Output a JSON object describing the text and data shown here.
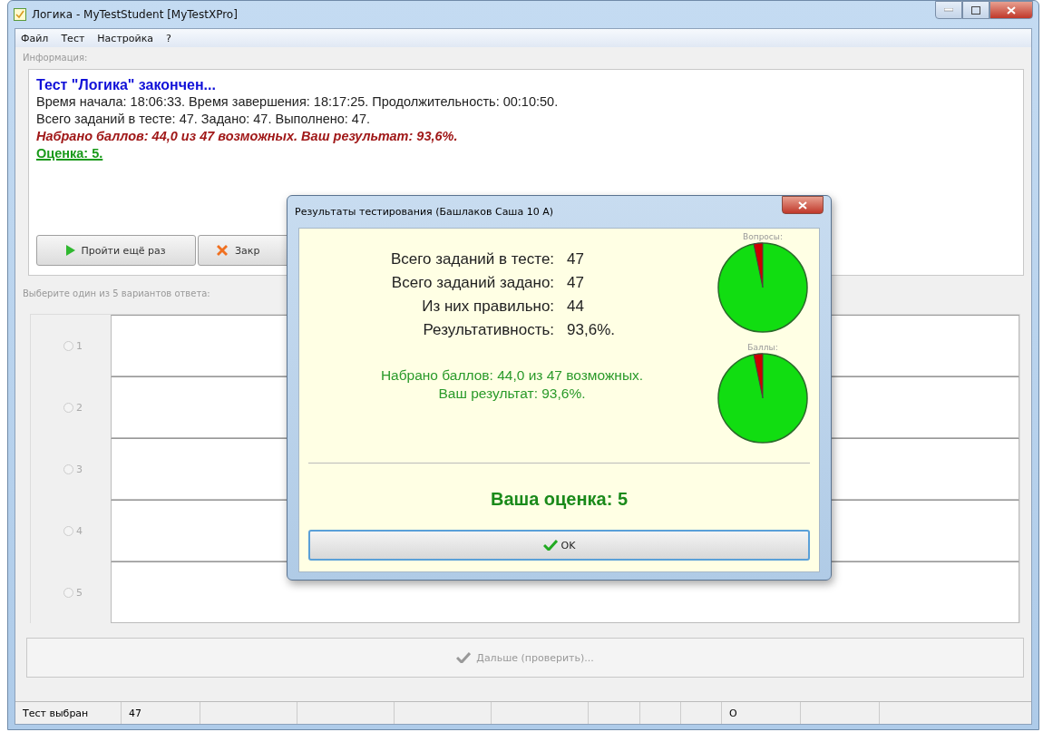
{
  "window": {
    "title": "Логика - MyTestStudent [MyTestXPro]"
  },
  "menu": [
    "Файл",
    "Тест",
    "Настройка",
    "?"
  ],
  "info": {
    "label": "Информация:",
    "lines": [
      {
        "kind": "title",
        "text": "Тест \"Логика\" закончен..."
      },
      {
        "kind": "plain",
        "text": "Время начала: 18:06:33. Время завершения: 18:17:25. Продолжительность: 00:10:50."
      },
      {
        "kind": "plain",
        "text": "Всего заданий в тесте: 47. Задано: 47. Выполнено: 47."
      },
      {
        "kind": "score",
        "text": "Набрано баллов: 44,0 из 47 возможных. Ваш результат: 93,6%."
      },
      {
        "kind": "grade",
        "text": "Оценка: 5."
      }
    ],
    "buttons": [
      {
        "kind": "play",
        "label": "Пройти ещё раз"
      },
      {
        "kind": "close",
        "label": "Закр"
      }
    ]
  },
  "answers": {
    "label": "Выберите один из 5 вариантов ответа:",
    "options": [
      {
        "number": "1",
        "selected": false
      },
      {
        "number": "2",
        "selected": false
      },
      {
        "number": "3",
        "selected": false
      },
      {
        "number": "4",
        "selected": false
      },
      {
        "number": "5",
        "selected": false
      }
    ]
  },
  "next_button": {
    "label": "Дальше (проверить)...",
    "disabled": true
  },
  "status_bar": {
    "cells": [
      "Тест выбран",
      "47"
    ],
    "indicator": "O"
  },
  "dialog": {
    "title": "Результаты тестирования (Башлаков Саша 10 А)",
    "stats": [
      {
        "label": "Всего заданий в тесте:",
        "value": "47"
      },
      {
        "label": "Всего заданий задано:",
        "value": "47"
      },
      {
        "label": "Из них правильно:",
        "value": "44"
      },
      {
        "label": "Результативность:",
        "value": "93,6%."
      }
    ],
    "result_lines": [
      "Набрано баллов: 44,0 из 47 возможных.",
      "Ваш результат: 93,6%."
    ],
    "pie_titles": [
      "Вопросы:",
      "Баллы:"
    ],
    "grade": "Ваша оценка: 5",
    "ok_button": "OK"
  }
}
